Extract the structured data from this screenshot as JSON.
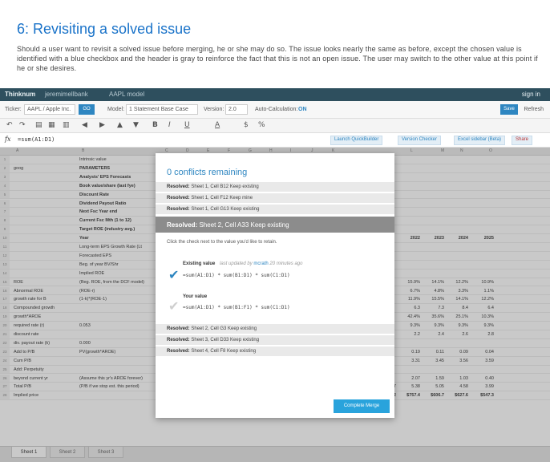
{
  "slide": {
    "title": "6: Revisiting a solved issue",
    "description": "Should a user want to revisit a solved issue before merging, he or she may do so. The issue looks nearly the same as before, except the chosen value is identified with a blue checkbox and the header is gray to reinforce the fact that this is not an open issue. The user may switch to the other value at this point if he or she desires."
  },
  "app": {
    "brand": "Thinknum",
    "crumb1": "jeremimellbank",
    "crumb2": "AAPL model",
    "signin": "sign in"
  },
  "ticker_bar": {
    "ticker_label": "Ticker:",
    "ticker_value": "AAPL / Apple Inc.",
    "go_label": "GO",
    "model_label": "Model:",
    "model_value": "1 Statement Base Case",
    "version_label": "Version:",
    "version_value": "2.0",
    "autocalc_label": "Auto-Calculation:",
    "autocalc_value": "ON",
    "save_label": "Save",
    "refresh_label": "Refresh"
  },
  "toolbar": {
    "bold": "B",
    "italic": "I",
    "underline": "U",
    "font_color": "A",
    "currency": "$",
    "percent": "%"
  },
  "formula_bar": {
    "fx": "fx",
    "formula": "=sum(A1:D1)",
    "chip1": "Launch QuickBuilder",
    "chip2": "Version Checker",
    "chip3": "Excel sidebar (Beta)",
    "chip4": "Share"
  },
  "grid": {
    "columns": [
      "A",
      "B",
      "C",
      "D",
      "E",
      "F",
      "G",
      "H",
      "I",
      "J",
      "K",
      "L",
      "M",
      "N",
      "O"
    ],
    "rows": [
      {
        "n": "1",
        "a": "",
        "b": "Intrinsic value",
        "bold": false,
        "r": [
          "",
          "",
          "",
          ""
        ]
      },
      {
        "n": "2",
        "a": "goog",
        "b": "PARAMETERS",
        "bold": true,
        "r": [
          "",
          "",
          "",
          ""
        ]
      },
      {
        "n": "3",
        "a": "",
        "b": "Analysts' EPS Forecasts",
        "bold": true,
        "r": [
          "",
          "",
          "",
          ""
        ]
      },
      {
        "n": "4",
        "a": "",
        "b": "Book value/share (last fye)",
        "bold": true,
        "r": [
          "",
          "",
          "",
          ""
        ]
      },
      {
        "n": "5",
        "a": "",
        "b": "Discount Rate",
        "bold": true,
        "r": [
          "",
          "",
          "",
          ""
        ]
      },
      {
        "n": "6",
        "a": "",
        "b": "Dividend Payout Ratio",
        "bold": true,
        "r": [
          "",
          "",
          "",
          ""
        ]
      },
      {
        "n": "7",
        "a": "",
        "b": "Next Fsc Year end",
        "bold": true,
        "r": [
          "",
          "",
          "",
          ""
        ]
      },
      {
        "n": "8",
        "a": "",
        "b": "Current Fsc Mth (1 to 12)",
        "bold": true,
        "r": [
          "",
          "",
          "",
          ""
        ]
      },
      {
        "n": "9",
        "a": "",
        "b": "Target ROE (industry avg.)",
        "bold": true,
        "r": [
          "",
          "",
          "",
          ""
        ]
      },
      {
        "n": "10",
        "a": "",
        "b": "Year",
        "bold": true,
        "r": [
          "2022",
          "2023",
          "2024",
          "2025"
        ]
      },
      {
        "n": "11",
        "a": "",
        "b": "Long-term EPS Growth Rate (Lt",
        "bold": false,
        "r": [
          "",
          "",
          "",
          ""
        ]
      },
      {
        "n": "12",
        "a": "",
        "b": "Forecasted EPS",
        "bold": false,
        "r": [
          "",
          "",
          "",
          ""
        ]
      },
      {
        "n": "13",
        "a": "",
        "b": "Beg. of year BV/Shr",
        "bold": false,
        "r": [
          "",
          "",
          "",
          ""
        ]
      },
      {
        "n": "14",
        "a": "",
        "b": "Implied ROE",
        "bold": false,
        "r": [
          "",
          "",
          "",
          ""
        ]
      },
      {
        "n": "15",
        "a": "ROE",
        "b": "(Beg. ROE, from the DCF model)",
        "bold": false,
        "r": [
          "15.9%",
          "14.1%",
          "12.2%",
          "10.9%"
        ]
      },
      {
        "n": "16",
        "a": "Abnormal ROE",
        "b": "(ROE-r)",
        "bold": false,
        "r": [
          "6.7%",
          "4.8%",
          "3.3%",
          "1.1%"
        ]
      },
      {
        "n": "17",
        "a": "growth rate for B",
        "b": "(1-k)*(ROE-1)",
        "bold": false,
        "r": [
          "11.9%",
          "15.5%",
          "14.1%",
          "12.2%"
        ]
      },
      {
        "n": "18",
        "a": "Compounded growth",
        "b": "",
        "bold": false,
        "r": [
          "6.3",
          "7.3",
          "8.4",
          "6.4"
        ]
      },
      {
        "n": "19",
        "a": "growth*AROE",
        "b": "",
        "bold": false,
        "r": [
          "42.4%",
          "35.6%",
          "25.1%",
          "10.3%"
        ]
      },
      {
        "n": "20",
        "a": "required rate (r)",
        "b": "0.053",
        "bold": false,
        "r": [
          "9.3%",
          "9.3%",
          "9.3%",
          "9.3%"
        ]
      },
      {
        "n": "21",
        "a": "discount rate",
        "b": "",
        "bold": false,
        "r": [
          "2.2",
          "2.4",
          "2.6",
          "2.8"
        ]
      },
      {
        "n": "22",
        "a": "div. payout rate (k)",
        "b": "0.000",
        "bold": false,
        "r": [
          "",
          "",
          "",
          ""
        ]
      },
      {
        "n": "23",
        "a": "Add to P/B",
        "b": "PV(growth*AROE)",
        "bold": false,
        "r": [
          "0.19",
          "0.11",
          "0.09",
          "0.04"
        ]
      },
      {
        "n": "24",
        "a": "Cum P/B",
        "b": "",
        "bold": false,
        "r": [
          "3.31",
          "3.45",
          "3.56",
          "3.59"
        ]
      },
      {
        "n": "25",
        "a": "Add: Perpetuity",
        "b": "",
        "bold": false,
        "r": [
          "",
          "",
          "",
          ""
        ]
      },
      {
        "n": "26",
        "a": "beyond current yr",
        "b": "(Assume this yr's AROE forever)",
        "bold": false,
        "r": [
          "2.07",
          "1.59",
          "1.03",
          "0.40"
        ]
      },
      {
        "n": "27",
        "a": "Total P/B",
        "b": "(P/B if we stop est. this period)",
        "bold": false,
        "r": [
          "5.38",
          "5.05",
          "4.58",
          "3.99"
        ]
      },
      {
        "n": "28",
        "a": "Implied price",
        "b": "",
        "bold": true,
        "r": [
          "$757.4",
          "$606.7",
          "$627.6",
          "$547.3"
        ]
      }
    ],
    "row27_mid": [
      "4.33",
      "1.36",
      "4.80",
      "5.05",
      "5.32",
      "5.53",
      "5.62",
      "5.57"
    ],
    "row28_mid": [
      "$593.1",
      "$624.3",
      "$657.2",
      "$661.0",
      "$721.2",
      "$757.0",
      "$760.4",
      "$763.2"
    ]
  },
  "sheet_tabs": [
    "Sheet 1",
    "Sheet 2",
    "Sheet 3"
  ],
  "modal": {
    "title": "0 conflicts remaining",
    "resolved_top": [
      {
        "prefix": "Resolved:",
        "text": "Sheet 1, Cell B12 Keep existing"
      },
      {
        "prefix": "Resolved:",
        "text": "Sheet 1, Cell F12 Keep mine"
      },
      {
        "prefix": "Resolved:",
        "text": "Sheet 1, Cell G13 Keep existing"
      }
    ],
    "current": {
      "prefix": "Resolved:",
      "text": "Sheet 2, Cell A33  Keep existing"
    },
    "instruction": "Click the check next to the value you'd like to retain.",
    "existing": {
      "label": "Existing value",
      "sub": "last updated by",
      "by": "mcrath",
      "ago": "20 minutes ago",
      "formula": "=sum(A1:D1) * sum(B1:D1) * sum(C1:D1)"
    },
    "yours": {
      "label": "Your value",
      "formula": "=sum(A1:D1) * sum(B1:F1) * sum(C1:D1)"
    },
    "resolved_bottom": [
      {
        "prefix": "Resolved:",
        "text": "Sheet 2, Cell G3  Keep existing"
      },
      {
        "prefix": "Resolved:",
        "text": "Sheet 3, Cell D33  Keep existing"
      },
      {
        "prefix": "Resolved:",
        "text": "Sheet 4, Cell F8  Keep existing"
      }
    ],
    "complete_label": "Complete Merge",
    "check_glyph": "✔"
  },
  "colors": {
    "accent": "#2e86c1",
    "topbar": "#2e4f5e",
    "current_row": "#8c8c8c",
    "complete_button": "#29a3dc"
  }
}
